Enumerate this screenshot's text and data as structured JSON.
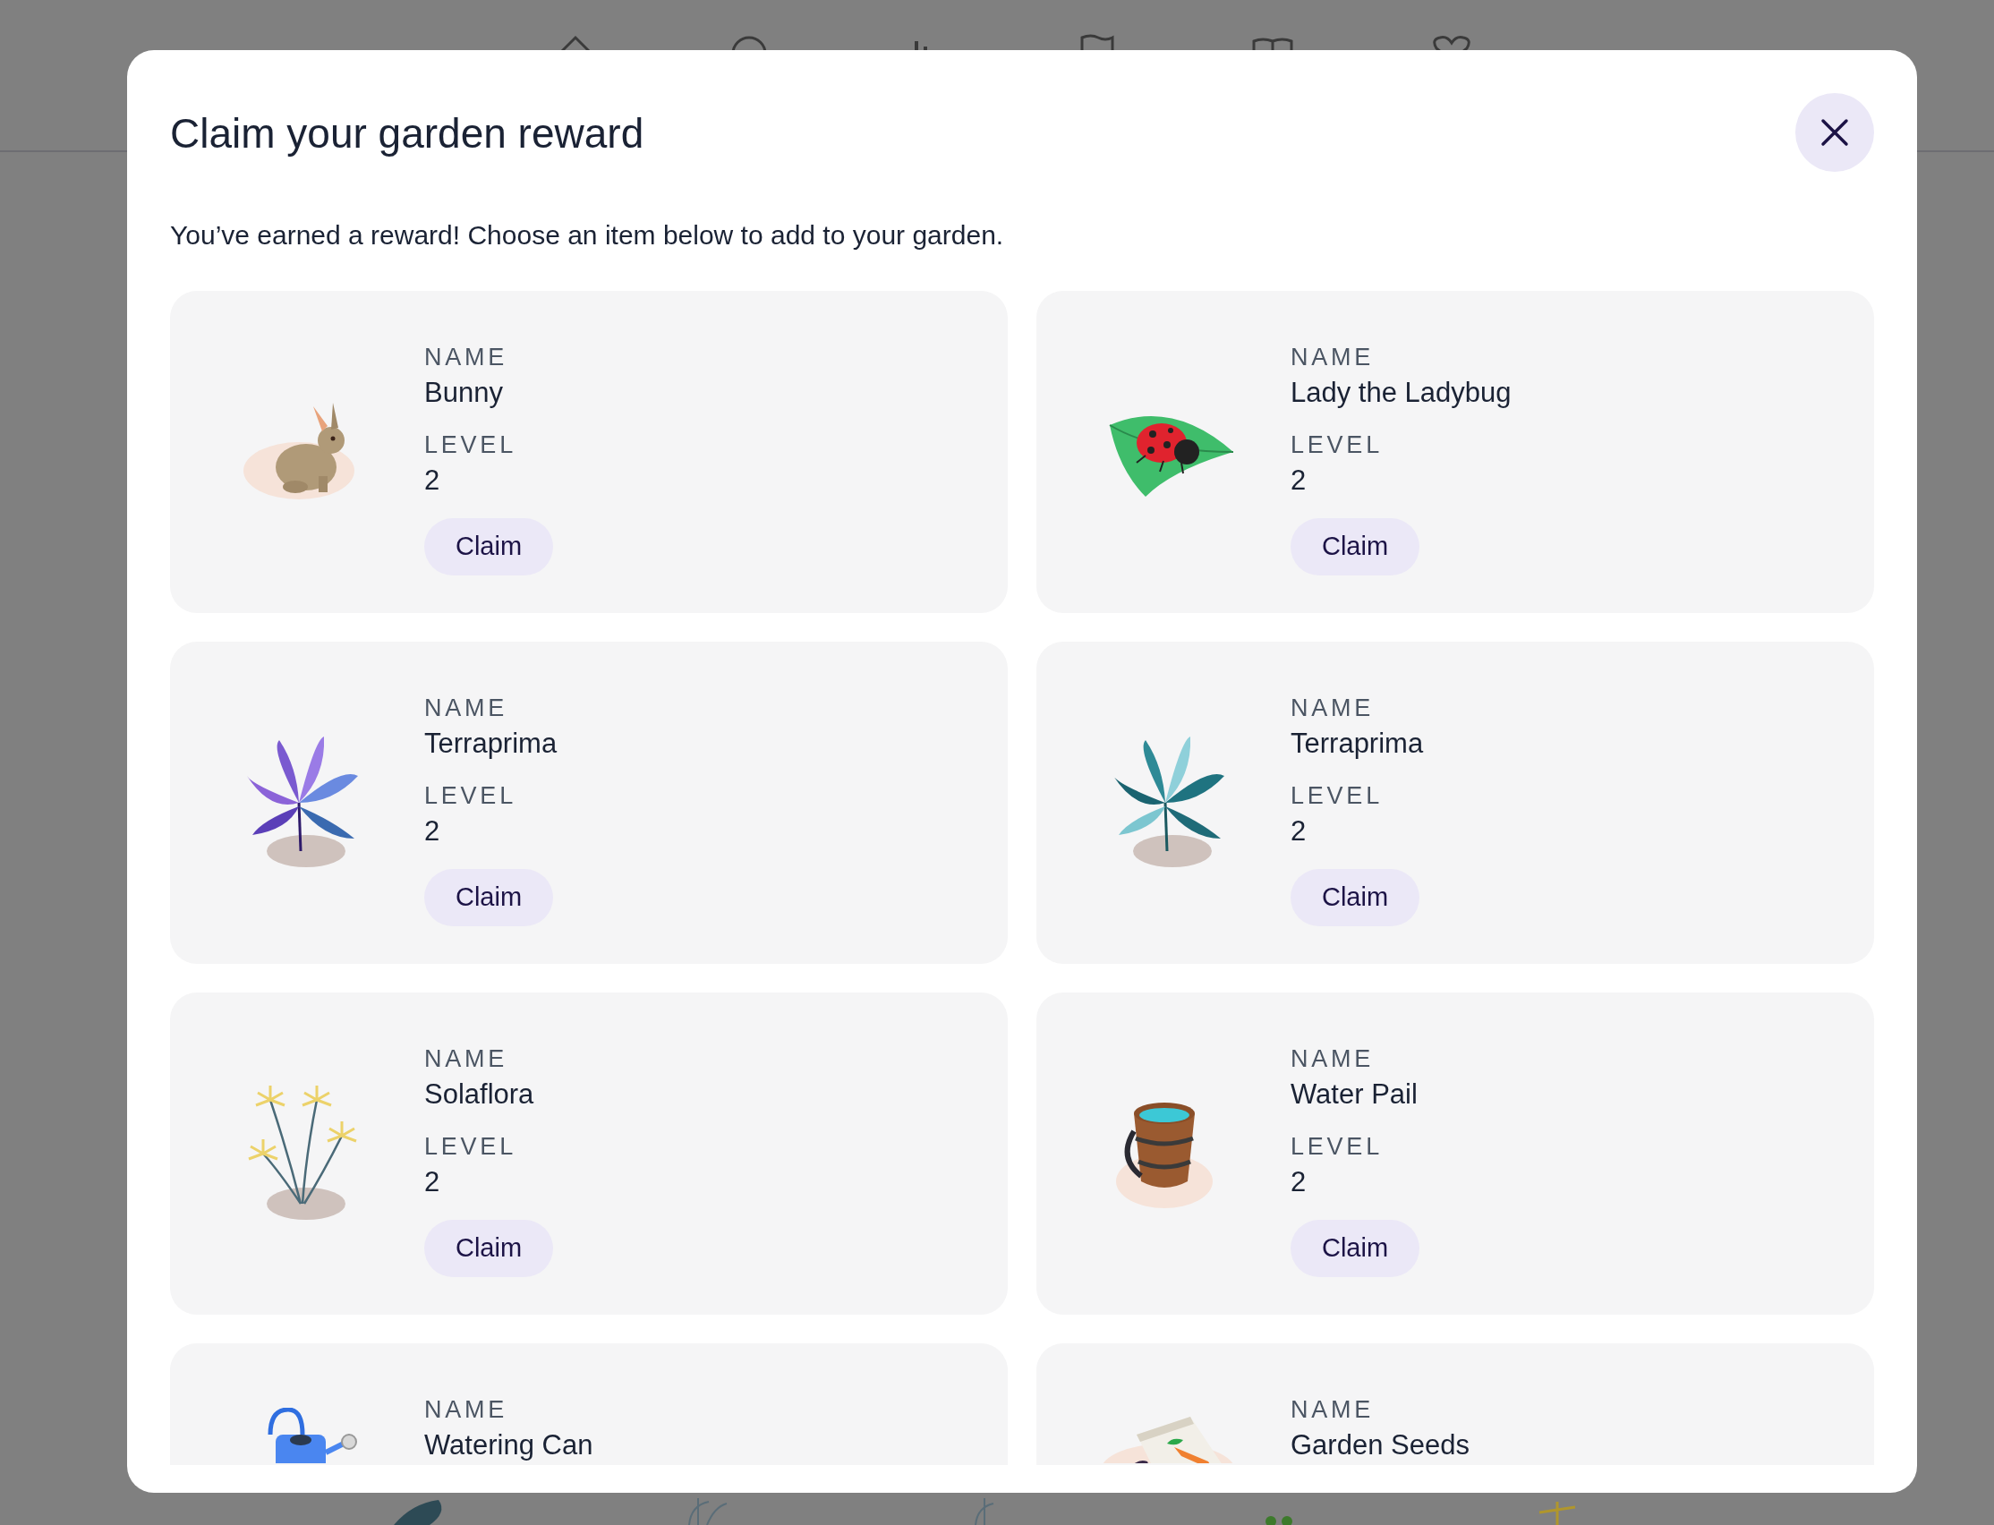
{
  "dialog": {
    "title": "Claim your garden reward",
    "description": "You’ve earned a reward! Choose an item below to add to your garden."
  },
  "rewards": [
    {
      "name_label": "NAME",
      "name": "Bunny",
      "level_label": "LEVEL",
      "level_value": "2",
      "button": "Claim"
    },
    {
      "name_label": "NAME",
      "name": "Lady the Ladybug",
      "level_label": "LEVEL",
      "level_value": "2",
      "button": "Claim"
    },
    {
      "name_label": "NAME",
      "name": "Terraprima",
      "level_label": "LEVEL",
      "level_value": "2",
      "button": "Claim"
    },
    {
      "name_label": "NAME",
      "name": "Terraprima",
      "level_label": "LEVEL",
      "level_value": "2",
      "button": "Claim"
    },
    {
      "name_label": "NAME",
      "name": "Solaflora",
      "level_label": "LEVEL",
      "level_value": "2",
      "button": "Claim"
    },
    {
      "name_label": "NAME",
      "name": "Water Pail",
      "level_label": "LEVEL",
      "level_value": "2",
      "button": "Claim"
    },
    {
      "name_label": "NAME",
      "name": "Watering Can"
    },
    {
      "name_label": "NAME",
      "name": "Garden Seeds"
    }
  ]
}
